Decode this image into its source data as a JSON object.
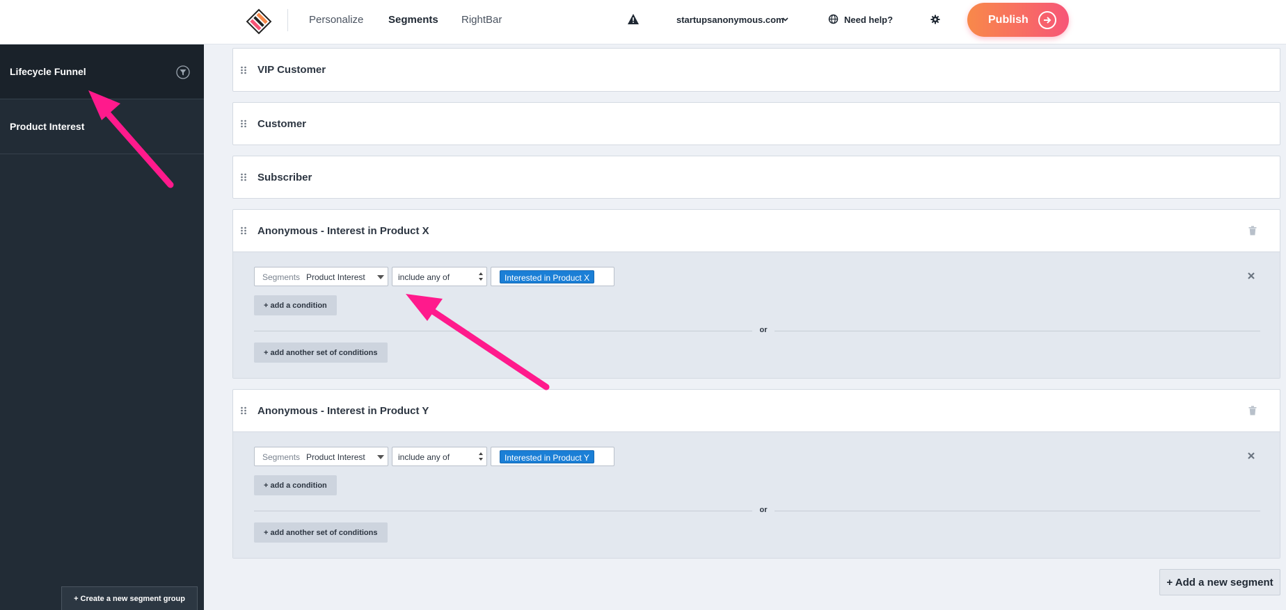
{
  "nav": {
    "links": [
      "Personalize",
      "Segments",
      "RightBar"
    ],
    "active": "Segments",
    "domain": "startupsanonymous.com",
    "help": "Need help?",
    "publish": "Publish"
  },
  "sidebar": {
    "items": [
      {
        "label": "Lifecycle Funnel"
      },
      {
        "label": "Product Interest"
      }
    ],
    "create_group": "+ Create a new segment group"
  },
  "segments": [
    {
      "title": "VIP Customer"
    },
    {
      "title": "Customer"
    },
    {
      "title": "Subscriber"
    },
    {
      "title": "Anonymous - Interest in Product X",
      "condition": {
        "prefix": "Segments",
        "value": "Product Interest",
        "operator": "include any of",
        "tag": "Interested in Product X"
      },
      "add_condition": "+ add a condition",
      "or": "or",
      "add_set": "+ add another set of conditions"
    },
    {
      "title": "Anonymous - Interest in Product Y",
      "condition": {
        "prefix": "Segments",
        "value": "Product Interest",
        "operator": "include any of",
        "tag": "Interested in Product Y"
      },
      "add_condition": "+ add a condition",
      "or": "or",
      "add_set": "+ add another set of conditions"
    }
  ],
  "add_segment": "+ Add a new segment",
  "colors": {
    "sidebar_bg": "#222c36",
    "publish_gradient_start": "#f8894a",
    "publish_gradient_end": "#f75577",
    "tag_blue": "#1b7fd6",
    "annotation_arrow": "#ff1a8c"
  },
  "icons": [
    "logo-icon",
    "warning-icon",
    "globe-icon",
    "gear-icon",
    "arrow-right-icon",
    "filter-icon",
    "drag-handle-icon",
    "trash-icon",
    "close-icon"
  ]
}
